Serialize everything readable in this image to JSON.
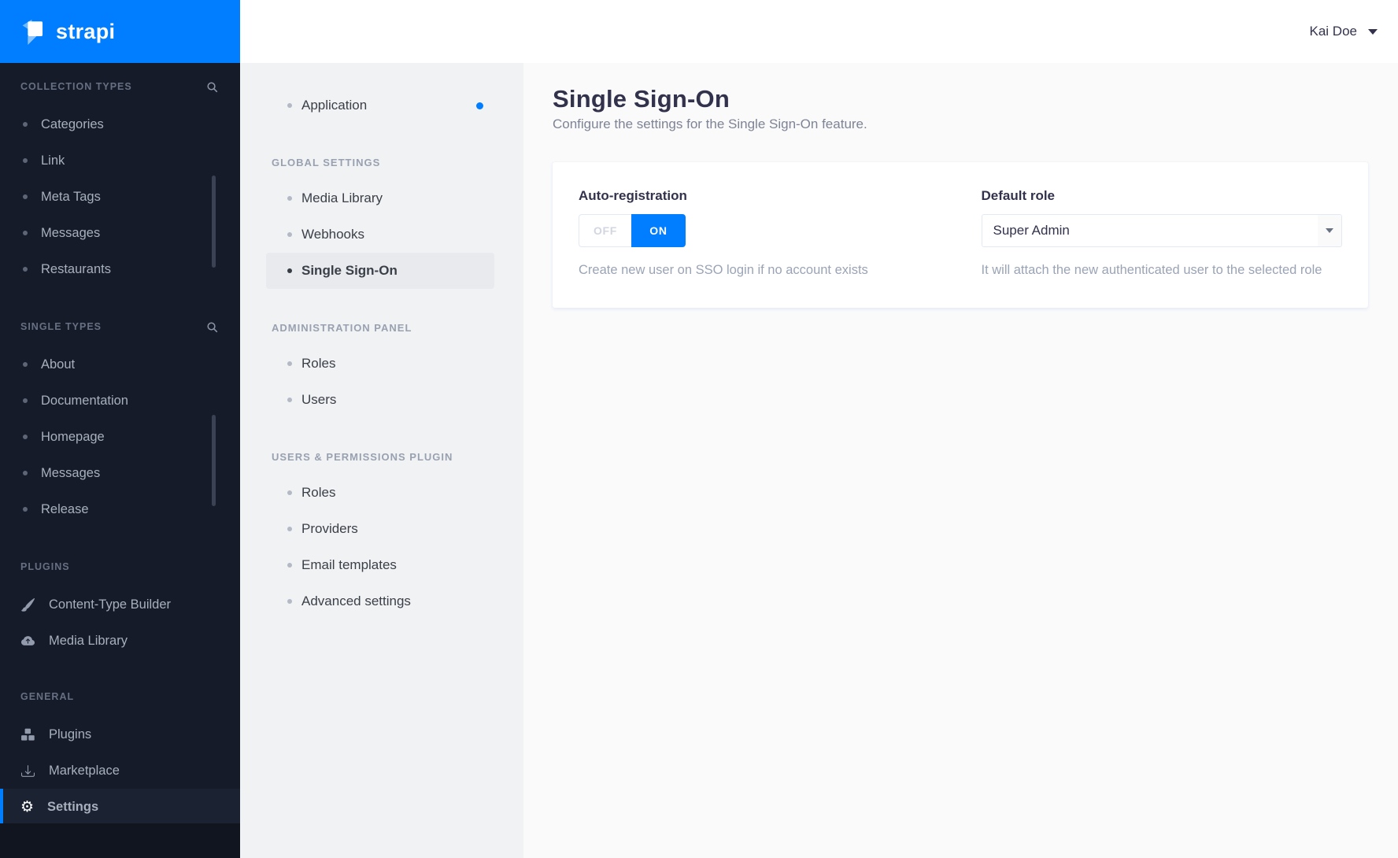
{
  "brand": {
    "name": "strapi",
    "accent_color": "#007eff"
  },
  "topbar": {
    "user_name": "Kai Doe",
    "caret_icon": "chevron-down"
  },
  "left_sidebar": {
    "sections": [
      {
        "label": "COLLECTION TYPES",
        "search_icon": "magnifier",
        "items": [
          {
            "label": "Categories"
          },
          {
            "label": "Link"
          },
          {
            "label": "Meta Tags"
          },
          {
            "label": "Messages"
          },
          {
            "label": "Restaurants"
          }
        ]
      },
      {
        "label": "SINGLE TYPES",
        "search_icon": "magnifier",
        "items": [
          {
            "label": "About"
          },
          {
            "label": "Documentation"
          },
          {
            "label": "Homepage"
          },
          {
            "label": "Messages"
          },
          {
            "label": "Release"
          }
        ]
      },
      {
        "label": "PLUGINS",
        "items": [
          {
            "label": "Content-Type Builder",
            "icon": "paintbrush"
          },
          {
            "label": "Media Library",
            "icon": "cloud-upload"
          }
        ]
      },
      {
        "label": "GENERAL",
        "items": [
          {
            "label": "Plugins",
            "icon": "cubes"
          },
          {
            "label": "Marketplace",
            "icon": "download"
          },
          {
            "label": "Settings",
            "icon": "gear",
            "active": true
          }
        ]
      }
    ]
  },
  "settings_menu": {
    "groups": [
      {
        "items": [
          {
            "label": "Application",
            "notification_dot": true
          }
        ]
      },
      {
        "header": "GLOBAL SETTINGS",
        "items": [
          {
            "label": "Media Library"
          },
          {
            "label": "Webhooks"
          },
          {
            "label": "Single Sign-On",
            "active": true
          }
        ]
      },
      {
        "header": "ADMINISTRATION PANEL",
        "items": [
          {
            "label": "Roles"
          },
          {
            "label": "Users"
          }
        ]
      },
      {
        "header": "USERS & PERMISSIONS PLUGIN",
        "items": [
          {
            "label": "Roles"
          },
          {
            "label": "Providers"
          },
          {
            "label": "Email templates"
          },
          {
            "label": "Advanced settings"
          }
        ]
      }
    ]
  },
  "page": {
    "title": "Single Sign-On",
    "subtitle": "Configure the settings for the Single Sign-On feature."
  },
  "form": {
    "auto_registration": {
      "label": "Auto-registration",
      "off_label": "OFF",
      "on_label": "ON",
      "value": "ON",
      "helper": "Create new user on SSO login if no account exists"
    },
    "default_role": {
      "label": "Default role",
      "value": "Super Admin",
      "helper": "It will attach the new authenticated user to the selected role"
    }
  },
  "colors": {
    "accent": "#007eff",
    "sidebar_bg": "#151b28",
    "settings_nav_bg": "#f1f2f4",
    "content_bg": "#fafafb",
    "title_text": "#32324d",
    "helper_text": "#9aa4b5"
  }
}
